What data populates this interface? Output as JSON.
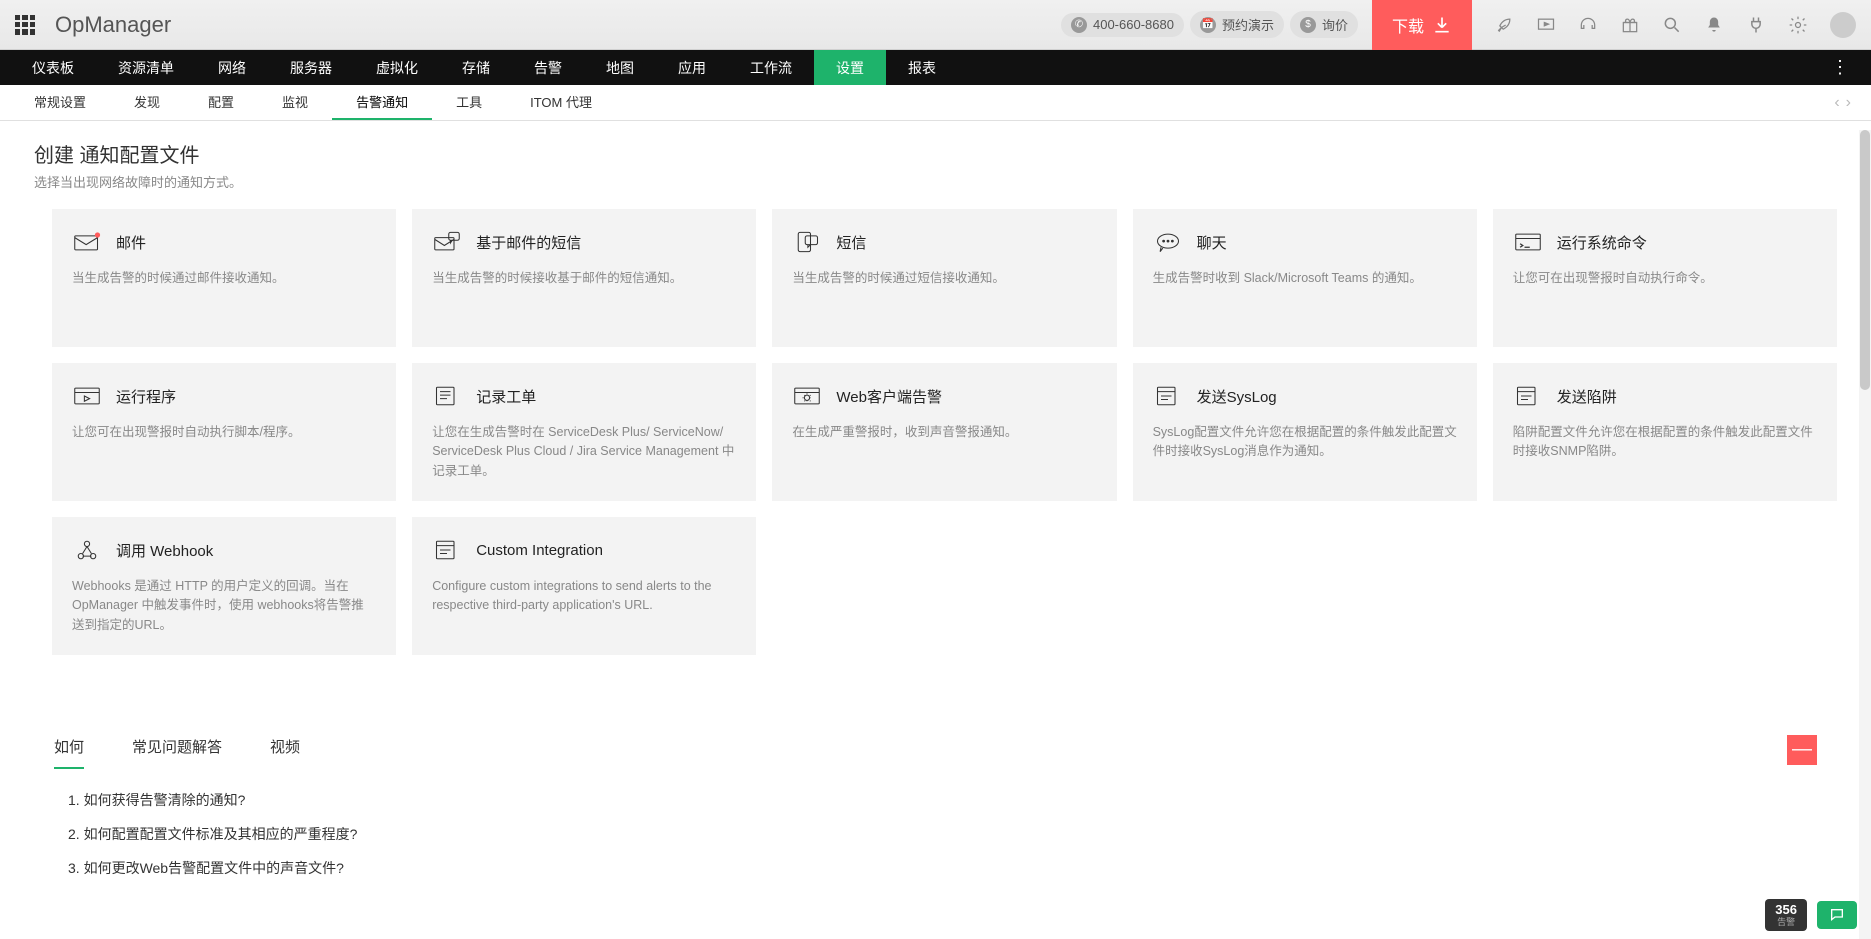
{
  "brand": "OpManager",
  "header": {
    "phone": "400-660-8680",
    "demo": "预约演示",
    "quote": "询价",
    "download": "下载"
  },
  "main_nav": [
    "仪表板",
    "资源清单",
    "网络",
    "服务器",
    "虚拟化",
    "存储",
    "告警",
    "地图",
    "应用",
    "工作流",
    "设置",
    "报表"
  ],
  "main_nav_active": 10,
  "sub_nav": [
    "常规设置",
    "发现",
    "配置",
    "监视",
    "告警通知",
    "工具",
    "ITOM 代理"
  ],
  "sub_nav_active": 4,
  "page_title": "创建 通知配置文件",
  "page_subtitle": "选择当出现网络故障时的通知方式。",
  "cards": [
    {
      "title": "邮件",
      "desc": "当生成告警的时候通过邮件接收通知。",
      "icon": "mail"
    },
    {
      "title": "基于邮件的短信",
      "desc": "当生成告警的时候接收基于邮件的短信通知。",
      "icon": "mail-sms"
    },
    {
      "title": "短信",
      "desc": "当生成告警的时候通过短信接收通知。",
      "icon": "sms"
    },
    {
      "title": "聊天",
      "desc": "生成告警时收到 Slack/Microsoft Teams 的通知。",
      "icon": "chat"
    },
    {
      "title": "运行系统命令",
      "desc": "让您可在出现警报时自动执行命令。",
      "icon": "command"
    },
    {
      "title": "运行程序",
      "desc": "让您可在出现警报时自动执行脚本/程序。",
      "icon": "program"
    },
    {
      "title": "记录工单",
      "desc": "让您在生成告警时在 ServiceDesk Plus/ ServiceNow/ ServiceDesk Plus Cloud / Jira Service Management 中记录工单。",
      "icon": "ticket"
    },
    {
      "title": "Web客户端告警",
      "desc": "在生成严重警报时，收到声音警报通知。",
      "icon": "web-alarm"
    },
    {
      "title": "发送SysLog",
      "desc": "SysLog配置文件允许您在根据配置的条件触发此配置文件时接收SysLog消息作为通知。",
      "icon": "syslog"
    },
    {
      "title": "发送陷阱",
      "desc": "陷阱配置文件允许您在根据配置的条件触发此配置文件时接收SNMP陷阱。",
      "icon": "trap"
    },
    {
      "title": "调用 Webhook",
      "desc": "Webhooks 是通过 HTTP 的用户定义的回调。当在 OpManager 中触发事件时，使用 webhooks将告警推送到指定的URL。",
      "icon": "webhook"
    },
    {
      "title": "Custom Integration",
      "desc": "Configure custom integrations to send alerts to the respective third-party application's URL.",
      "icon": "custom"
    }
  ],
  "help": {
    "tabs": [
      "如何",
      "常见问题解答",
      "视频"
    ],
    "active": 0,
    "items": [
      "1. 如何获得告警清除的通知?",
      "2. 如何配置配置文件标准及其相应的严重程度?",
      "3. 如何更改Web告警配置文件中的声音文件?"
    ]
  },
  "footer_count": "356",
  "footer_count_label": "告警"
}
